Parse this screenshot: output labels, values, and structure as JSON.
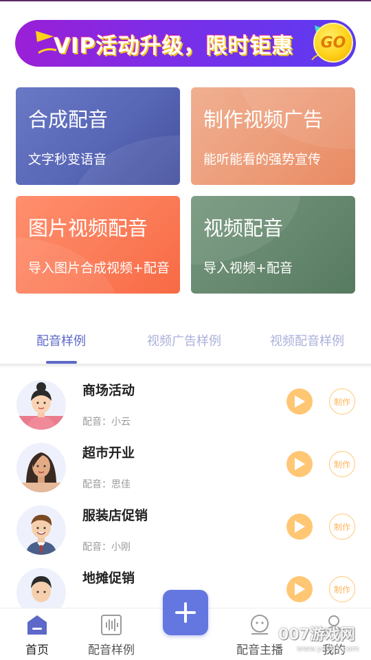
{
  "banner": {
    "text": "VIP活动升级，限时钜惠",
    "go_label": "GO"
  },
  "cards": [
    {
      "title": "合成配音",
      "subtitle": "文字秒变语音"
    },
    {
      "title": "制作视频广告",
      "subtitle": "能听能看的强势宣传"
    },
    {
      "title": "图片视频配音",
      "subtitle": "导入图片合成视频+配音"
    },
    {
      "title": "视频配音",
      "subtitle": "导入视频+配音"
    }
  ],
  "tabs": [
    {
      "label": "配音样例",
      "active": true
    },
    {
      "label": "视频广告样例",
      "active": false
    },
    {
      "label": "视频配音样例",
      "active": false
    }
  ],
  "samples": [
    {
      "title": "商场活动",
      "voice": "配音：小云",
      "make_label": "制作"
    },
    {
      "title": "超市开业",
      "voice": "配音：思佳",
      "make_label": "制作"
    },
    {
      "title": "服装店促销",
      "voice": "配音：小刚",
      "make_label": "制作"
    },
    {
      "title": "地摊促销",
      "voice": "",
      "make_label": "制作"
    }
  ],
  "bottom_nav": [
    {
      "label": "首页",
      "icon": "home-icon",
      "active": true
    },
    {
      "label": "配音样例",
      "icon": "waveform-icon",
      "active": false
    },
    {
      "label": "配音主播",
      "icon": "robot-face-icon",
      "active": false
    },
    {
      "label": "我的",
      "icon": "user-icon",
      "active": false
    }
  ],
  "watermark": {
    "text": "007游戏网",
    "url": "www.yx007.com"
  },
  "colors": {
    "accent": "#5d68c8",
    "play": "#ffc774",
    "fab": "#6477e0"
  }
}
